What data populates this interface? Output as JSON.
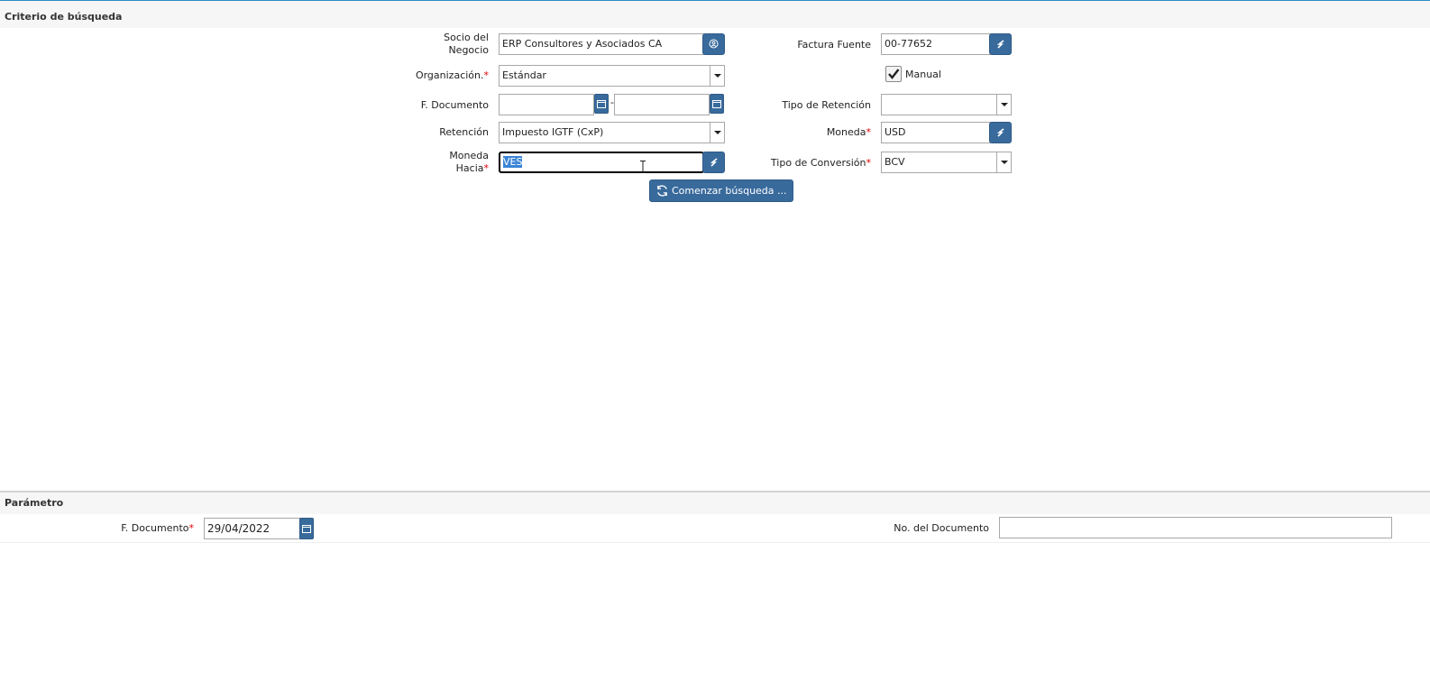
{
  "search_section": {
    "title": "Criterio de búsqueda",
    "socio": {
      "label": "Socio del Negocio",
      "value": "ERP Consultores y Asociados CA"
    },
    "organizacion": {
      "label": "Organización.",
      "required_mark": "*",
      "value": "Estándar"
    },
    "f_documento": {
      "label": "F. Documento",
      "from": "",
      "to": "",
      "separator": "-"
    },
    "retencion": {
      "label": "Retención",
      "value": "Impuesto IGTF (CxP)"
    },
    "moneda_hacia": {
      "label_line1": "Moneda",
      "label_line2": "Hacia",
      "required_mark": "*",
      "value": "VES"
    },
    "factura_fuente": {
      "label": "Factura Fuente",
      "value": "00-77652"
    },
    "manual": {
      "label": "Manual",
      "checked": true
    },
    "tipo_retencion": {
      "label": "Tipo de Retención",
      "value": ""
    },
    "moneda": {
      "label": "Moneda",
      "required_mark": "*",
      "value": "USD"
    },
    "tipo_conversion": {
      "label": "Tipo de Conversión",
      "required_mark": "*",
      "value": "BCV"
    },
    "search_button": "Comenzar búsqueda ..."
  },
  "param_section": {
    "title": "Parámetro",
    "f_documento": {
      "label": "F. Documento",
      "required_mark": "*",
      "value": "29/04/2022"
    },
    "no_documento": {
      "label": "No. del Documento",
      "value": ""
    }
  },
  "colors": {
    "accent": "#396a9c",
    "required": "#e00000",
    "selection": "#3b84d6"
  },
  "icons": [
    "bp-search-icon",
    "lookup-arrow-icon",
    "calendar-icon",
    "dropdown-arrow-icon",
    "check-icon",
    "refresh-icon"
  ]
}
